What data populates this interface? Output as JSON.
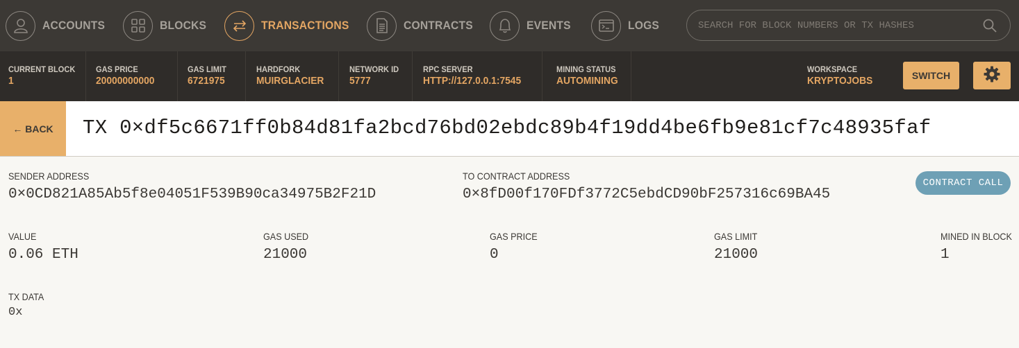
{
  "nav": {
    "items": [
      {
        "label": "ACCOUNTS",
        "icon": "user-icon",
        "active": false
      },
      {
        "label": "BLOCKS",
        "icon": "grid-icon",
        "active": false
      },
      {
        "label": "TRANSACTIONS",
        "icon": "swap-arrows-icon",
        "active": true
      },
      {
        "label": "CONTRACTS",
        "icon": "document-icon",
        "active": false
      },
      {
        "label": "EVENTS",
        "icon": "bell-icon",
        "active": false
      },
      {
        "label": "LOGS",
        "icon": "terminal-icon",
        "active": false
      }
    ],
    "search_placeholder": "SEARCH FOR BLOCK NUMBERS OR TX HASHES"
  },
  "status": {
    "current_block": {
      "label": "CURRENT BLOCK",
      "value": "1"
    },
    "gas_price": {
      "label": "GAS PRICE",
      "value": "20000000000"
    },
    "gas_limit": {
      "label": "GAS LIMIT",
      "value": "6721975"
    },
    "hardfork": {
      "label": "HARDFORK",
      "value": "MUIRGLACIER"
    },
    "network_id": {
      "label": "NETWORK ID",
      "value": "5777"
    },
    "rpc_server": {
      "label": "RPC SERVER",
      "value": "HTTP://127.0.0.1:7545"
    },
    "mining_status": {
      "label": "MINING STATUS",
      "value": "AUTOMINING"
    },
    "workspace": {
      "label": "WORKSPACE",
      "value": "KRYPTOJOBS"
    },
    "switch_label": "SWITCH"
  },
  "tx": {
    "back_label": "← BACK",
    "title": "TX 0×df5c6671ff0b84d81fa2bcd76bd02ebdc89b4f19dd4be6fb9e81cf7c48935faf",
    "sender": {
      "label": "SENDER ADDRESS",
      "value": "0×0CD821A85Ab5f8e04051F539B90ca34975B2F21D"
    },
    "to_contract": {
      "label": "TO CONTRACT ADDRESS",
      "value": "0×8fD00f170FDf3772C5ebdCD90bF257316c69BA45"
    },
    "badge": "CONTRACT CALL",
    "value": {
      "label": "VALUE",
      "value": "0.06 ETH"
    },
    "gas_used": {
      "label": "GAS USED",
      "value": "21000"
    },
    "gas_price": {
      "label": "GAS PRICE",
      "value": "0"
    },
    "gas_limit": {
      "label": "GAS LIMIT",
      "value": "21000"
    },
    "mined_in_block": {
      "label": "MINED IN BLOCK",
      "value": "1"
    },
    "tx_data": {
      "label": "TX DATA",
      "value": "0x"
    }
  },
  "colors": {
    "accent": "#e4a663",
    "nav_bg": "#3c3935",
    "status_bg": "#2f2c29",
    "badge": "#6ea0b5"
  }
}
